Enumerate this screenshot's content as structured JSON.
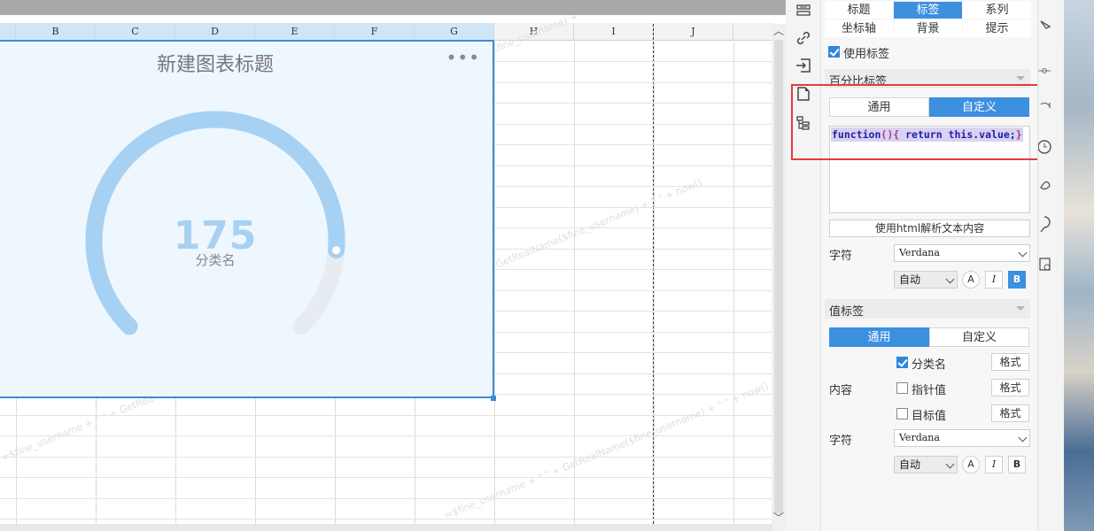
{
  "sheet": {
    "columns": [
      {
        "label": "B",
        "selected": true
      },
      {
        "label": "C",
        "selected": true
      },
      {
        "label": "D",
        "selected": true
      },
      {
        "label": "E",
        "selected": true
      },
      {
        "label": "F",
        "selected": true
      },
      {
        "label": "G",
        "selected": true
      },
      {
        "label": "H",
        "selected": false
      },
      {
        "label": "I",
        "selected": false
      },
      {
        "label": "J",
        "selected": false
      }
    ],
    "watermark_text": "=$fine_username + \" \" + GetRealName($fine_username) + \" \" + now()"
  },
  "chart": {
    "title": "新建图表标题",
    "menu_icon": "more-icon",
    "value": "175",
    "category": "分类名",
    "colors": {
      "arc": "#a6d1f3",
      "track": "#e6ecf2",
      "border": "#3d8bdb",
      "background": "#eef6fe"
    }
  },
  "chart_data": {
    "type": "gauge",
    "title": "新建图表标题",
    "value": 175,
    "category": "分类名",
    "fill_fraction": 0.85
  },
  "panel": {
    "tabs": [
      {
        "label": "标题",
        "active": false
      },
      {
        "label": "标签",
        "active": true
      },
      {
        "label": "系列",
        "active": false
      },
      {
        "label": "坐标轴",
        "active": false
      },
      {
        "label": "背景",
        "active": false
      },
      {
        "label": "提示",
        "active": false
      }
    ],
    "use_label": {
      "label": "使用标签",
      "checked": true
    },
    "percent_label": {
      "section_title": "百分比标签",
      "modes": [
        {
          "label": "通用",
          "active": false
        },
        {
          "label": "自定义",
          "active": true
        }
      ],
      "code": "function(){ return this.value;}",
      "html_button": "使用html解析文本内容",
      "font_label": "字符",
      "font_family": "Verdana",
      "font_size": "自动",
      "bold_active": true
    },
    "value_label": {
      "section_title": "值标签",
      "modes": [
        {
          "label": "通用",
          "active": true
        },
        {
          "label": "自定义",
          "active": false
        }
      ],
      "content_label": "内容",
      "items": [
        {
          "label": "分类名",
          "checked": true,
          "format": "格式"
        },
        {
          "label": "指针值",
          "checked": false,
          "format": "格式"
        },
        {
          "label": "目标值",
          "checked": false,
          "format": "格式"
        }
      ],
      "font_label": "字符",
      "font_family": "Verdana",
      "font_size": "自动",
      "bold_active": false
    },
    "style_buttons": {
      "color": "A",
      "italic": "I",
      "bold": "B"
    }
  },
  "iconbar": [
    "cell-element-icon",
    "hyperlink-icon",
    "insert-icon",
    "chart-property-icon",
    "widget-tree-icon"
  ],
  "highlight_color": "#e53b3b"
}
